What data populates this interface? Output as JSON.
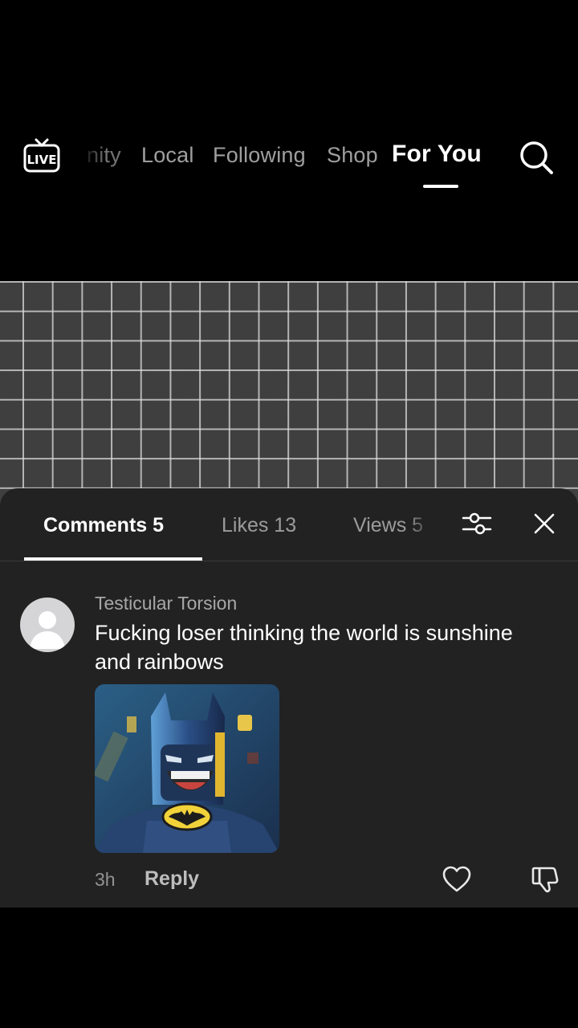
{
  "topnav": {
    "live_icon": "live-tv-icon",
    "live_label": "LIVE",
    "tabs": [
      {
        "label": "nity",
        "active": false
      },
      {
        "label": "Local",
        "active": false
      },
      {
        "label": "Following",
        "active": false
      },
      {
        "label": "Shop",
        "active": false
      },
      {
        "label": "For You",
        "active": true
      }
    ],
    "search_icon": "search-icon"
  },
  "sheet": {
    "tabs": [
      {
        "label": "Comments 5",
        "active": true
      },
      {
        "label": "Likes 13",
        "active": false
      },
      {
        "label": "Views 5",
        "active": false
      }
    ],
    "filter_icon": "filter-sliders-icon",
    "close_icon": "close-icon"
  },
  "comment": {
    "username": "Testicular Torsion",
    "text": "Fucking loser thinking the world is sunshine and rainbows",
    "time": "3h",
    "reply_label": "Reply",
    "like_icon": "heart-icon",
    "dislike_icon": "dislike-icon"
  },
  "colors": {
    "background": "#000000",
    "sheet": "#222222",
    "grid_bg": "#3f3f3f",
    "accent": "#ffffff"
  }
}
